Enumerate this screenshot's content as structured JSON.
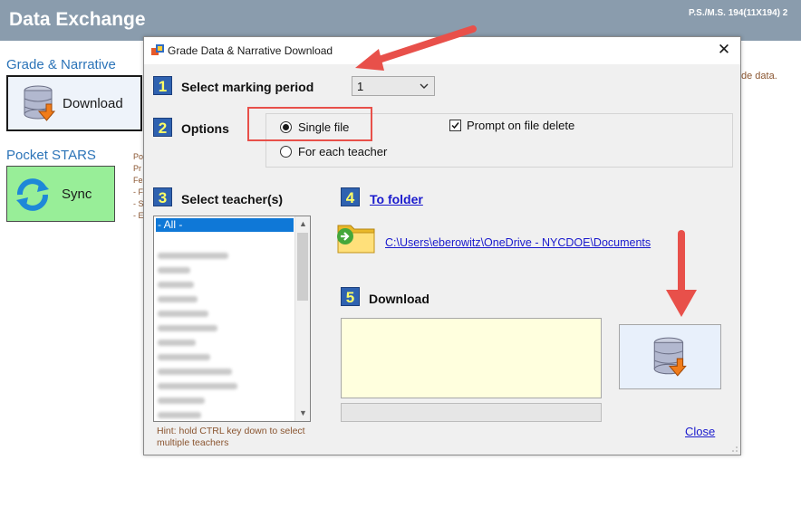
{
  "app": {
    "title": "Data Exchange",
    "school": "P.S./M.S. 194(11X194) 2",
    "grade_section_title": "Grade & Narrative",
    "download_label": "Download",
    "pocket_section_title": "Pocket STARS",
    "sync_label": "Sync",
    "side_fragments": [
      "Po",
      "Pr",
      "Fe",
      "- F",
      "- S",
      "- E"
    ],
    "right_fragment": "de data."
  },
  "dialog": {
    "title": "Grade Data & Narrative Download",
    "steps": {
      "s1": {
        "num": "1",
        "label": "Select marking period"
      },
      "s2": {
        "num": "2",
        "label": "Options"
      },
      "s3": {
        "num": "3",
        "label": "Select teacher(s)"
      },
      "s4": {
        "num": "4",
        "label": "To folder"
      },
      "s5": {
        "num": "5",
        "label": "Download"
      }
    },
    "marking_period": "1",
    "options": {
      "single_file": "Single file",
      "each_teacher": "For each teacher",
      "prompt_delete": "Prompt on file delete"
    },
    "teacher_list": {
      "selected": "- All -"
    },
    "hint": "Hint: hold CTRL key down to select multiple teachers",
    "folder_path": "C:\\Users\\eberowitz\\OneDrive - NYCDOE\\Documents",
    "close_label": "Close"
  },
  "colors": {
    "accent_red": "#e8504a",
    "step_badge": "#2f62b0",
    "link": "#1a1acd",
    "header_bg": "#8a9cad"
  }
}
